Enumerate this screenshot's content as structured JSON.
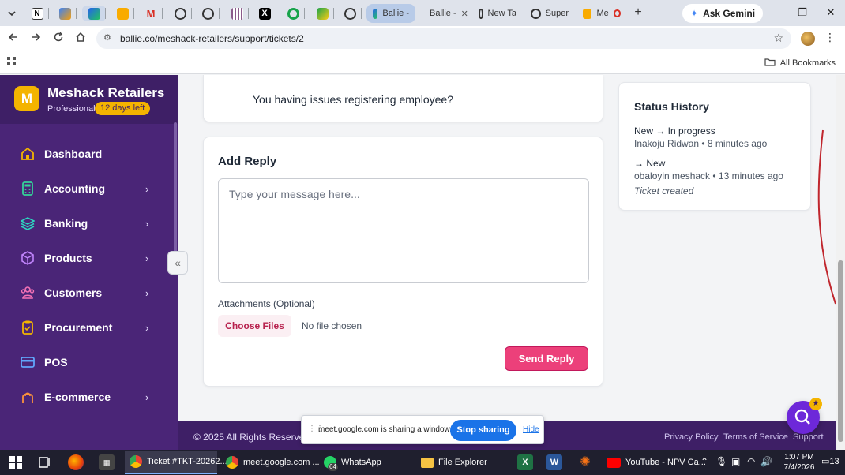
{
  "browser": {
    "pinned_tabs": [
      "tab-1",
      "tab-2",
      "tab-3",
      "tab-4",
      "tab-5",
      "tab-6",
      "tab-7",
      "tab-8",
      "tab-9",
      "tab-10",
      "tab-11",
      "tab-12"
    ],
    "tabs": [
      {
        "label": "Ballie -",
        "active": true
      },
      {
        "label": "Ballie -",
        "active": false
      },
      {
        "label": "New Ta",
        "active": false
      },
      {
        "label": "Super",
        "active": false
      },
      {
        "label": "Me",
        "active": false
      }
    ],
    "new_tab_symbol": "+",
    "gemini_label": "Ask Gemini",
    "url": "ballie.co/meshack-retailers/support/tickets/2",
    "bookmarks_label": "All Bookmarks"
  },
  "sidebar": {
    "brand_initial": "M",
    "brand_name": "Meshack Retailers",
    "plan": "Professional",
    "trial": "12 days left",
    "items": [
      {
        "label": "Dashboard",
        "icon": "home-icon",
        "has_children": false
      },
      {
        "label": "Accounting",
        "icon": "calculator-icon",
        "has_children": true
      },
      {
        "label": "Banking",
        "icon": "layers-icon",
        "has_children": true
      },
      {
        "label": "Products",
        "icon": "box-icon",
        "has_children": true
      },
      {
        "label": "Customers",
        "icon": "users-icon",
        "has_children": true
      },
      {
        "label": "Procurement",
        "icon": "clipboard-icon",
        "has_children": true
      },
      {
        "label": "POS",
        "icon": "card-icon",
        "has_children": false
      },
      {
        "label": "E-commerce",
        "icon": "shop-icon",
        "has_children": true
      }
    ]
  },
  "message": {
    "text": "You having issues registering employee?"
  },
  "reply": {
    "title": "Add Reply",
    "placeholder": "Type your message here...",
    "attachments_label": "Attachments (Optional)",
    "choose_files": "Choose Files",
    "no_file": "No file chosen",
    "send": "Send Reply"
  },
  "status_history": {
    "title": "Status History",
    "entries": [
      {
        "transition": "New → In progress",
        "meta": "Inakoju Ridwan • 8 minutes ago",
        "note": ""
      },
      {
        "transition": "→ New",
        "meta": "obaloyin meshack • 13 minutes ago",
        "note": "Ticket created"
      }
    ]
  },
  "footer": {
    "copyright": "© 2025 All Rights Reserve",
    "links": [
      "Privacy Policy",
      "Terms of Service",
      "Support"
    ]
  },
  "screen_share": {
    "text": "meet.google.com is sharing a window.",
    "stop": "Stop sharing",
    "hide": "Hide"
  },
  "taskbar": {
    "apps": [
      {
        "label": "Ticket #TKT-20262...",
        "active": true
      },
      {
        "label": "meet.google.com ...",
        "active": false
      },
      {
        "label": "WhatsApp",
        "active": false
      },
      {
        "label": "File Explorer",
        "active": false
      },
      {
        "label": "YouTube - NPV Ca...",
        "active": false
      }
    ],
    "whatsapp_badge": "64",
    "time": "1:07 PM",
    "date": "7/4/2026",
    "notification_count": "13"
  },
  "colors": {
    "sidebar": "#4a2577",
    "brand_accent": "#f4b400",
    "primary_button": "#ec407a",
    "share_button": "#1a73e8"
  }
}
